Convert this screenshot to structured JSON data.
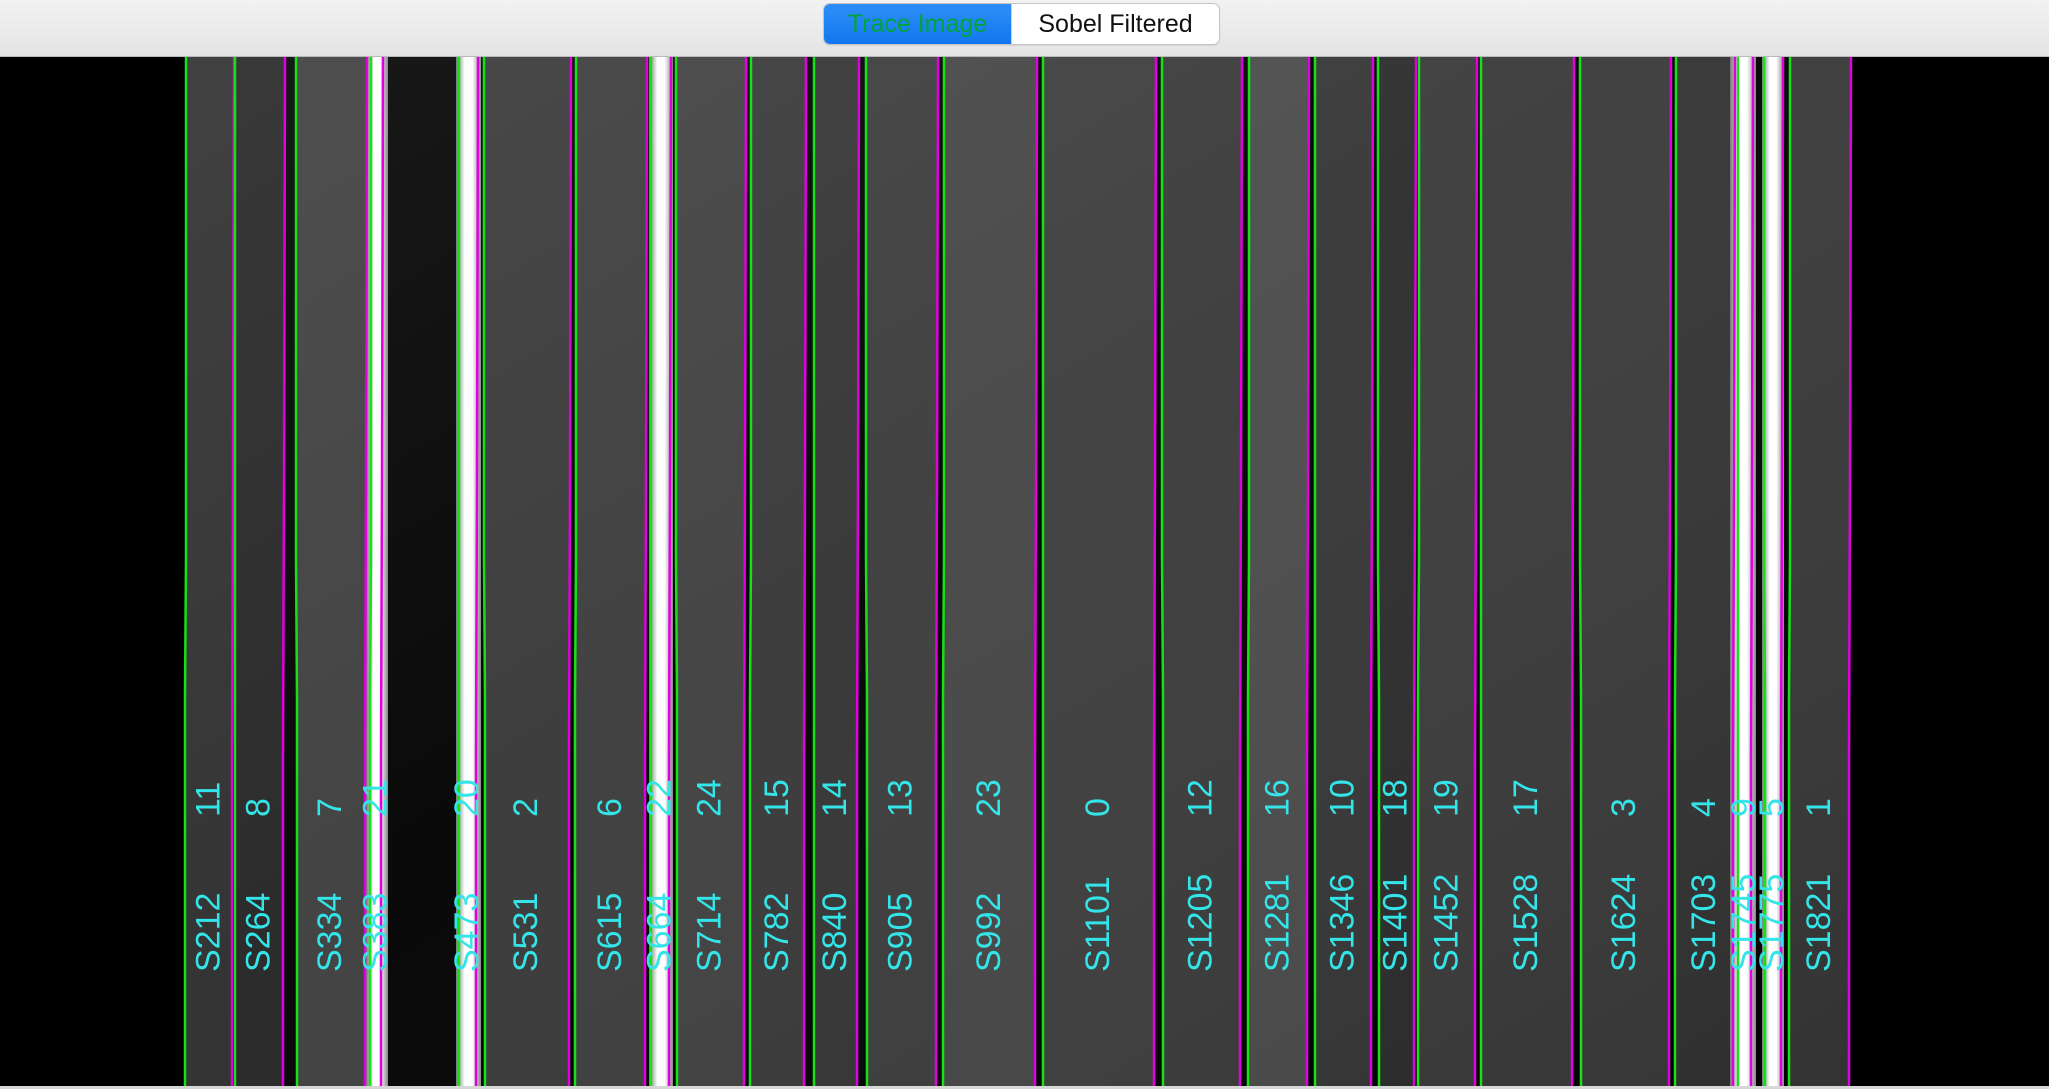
{
  "toolbar": {
    "tabs": [
      {
        "label": "Trace Image",
        "selected": true
      },
      {
        "label": "Sobel Filtered",
        "selected": false
      }
    ]
  },
  "colors": {
    "accent": "#1a7ff1",
    "selected_text": "#00a53a",
    "left_trace": "#16e016",
    "right_trace": "#e000e0",
    "label": "#33e4e8",
    "background": "#000000"
  },
  "slits": [
    {
      "name": "S212",
      "id": "11"
    },
    {
      "name": "S264",
      "id": "8"
    },
    {
      "name": "S334",
      "id": "7"
    },
    {
      "name": "S383",
      "id": "21"
    },
    {
      "name": "S473",
      "id": "20"
    },
    {
      "name": "S531",
      "id": "2"
    },
    {
      "name": "S615",
      "id": "6"
    },
    {
      "name": "S664",
      "id": "22"
    },
    {
      "name": "S714",
      "id": "24"
    },
    {
      "name": "S782",
      "id": "15"
    },
    {
      "name": "S840",
      "id": "14"
    },
    {
      "name": "S905",
      "id": "13"
    },
    {
      "name": "S992",
      "id": "23"
    },
    {
      "name": "S1101",
      "id": "0"
    },
    {
      "name": "S1205",
      "id": "12"
    },
    {
      "name": "S1281",
      "id": "16"
    },
    {
      "name": "S1346",
      "id": "10"
    },
    {
      "name": "S1401",
      "id": "18"
    },
    {
      "name": "S1452",
      "id": "19"
    },
    {
      "name": "S1528",
      "id": "17"
    },
    {
      "name": "S1624",
      "id": "3"
    },
    {
      "name": "S1703",
      "id": "4"
    },
    {
      "name": "S1745",
      "id": "9"
    },
    {
      "name": "S1775",
      "id": "5"
    },
    {
      "name": "S1821",
      "id": "1"
    }
  ]
}
